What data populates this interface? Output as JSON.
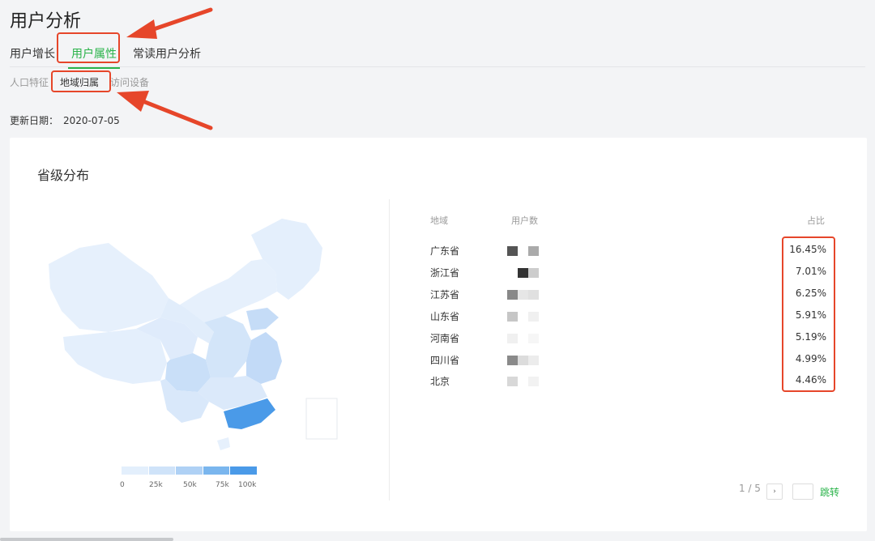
{
  "page": {
    "title": "用户分析"
  },
  "tabs": [
    {
      "label": "用户增长"
    },
    {
      "label": "用户属性"
    },
    {
      "label": "常读用户分析"
    }
  ],
  "subtabs": [
    {
      "label": "人口特征"
    },
    {
      "label": "地域归属"
    },
    {
      "label": "访问设备"
    }
  ],
  "update": {
    "label": "更新日期：",
    "date": "2020-07-05"
  },
  "card": {
    "title": "省级分布",
    "legend": {
      "labels": [
        "0",
        "25k",
        "50k",
        "75k",
        "100k"
      ],
      "colors": [
        "#e3effc",
        "#cfe3f9",
        "#afd1f5",
        "#7ab6ee",
        "#4a9ae8"
      ]
    },
    "table": {
      "headers": {
        "region": "地域",
        "users": "用户数",
        "pct": "占比"
      },
      "rows": [
        {
          "region": "广东省",
          "pct": "16.45%"
        },
        {
          "region": "浙江省",
          "pct": "7.01%"
        },
        {
          "region": "江苏省",
          "pct": "6.25%"
        },
        {
          "region": "山东省",
          "pct": "5.91%"
        },
        {
          "region": "河南省",
          "pct": "5.19%"
        },
        {
          "region": "四川省",
          "pct": "4.99%"
        },
        {
          "region": "北京",
          "pct": "4.46%"
        }
      ]
    },
    "pager": {
      "text": "1 / 5",
      "next": "›",
      "jump": "跳转"
    }
  },
  "colors": {
    "accent": "#2ab34a",
    "annotation": "#e6462a",
    "highlight_province": "#4a9ae8"
  }
}
